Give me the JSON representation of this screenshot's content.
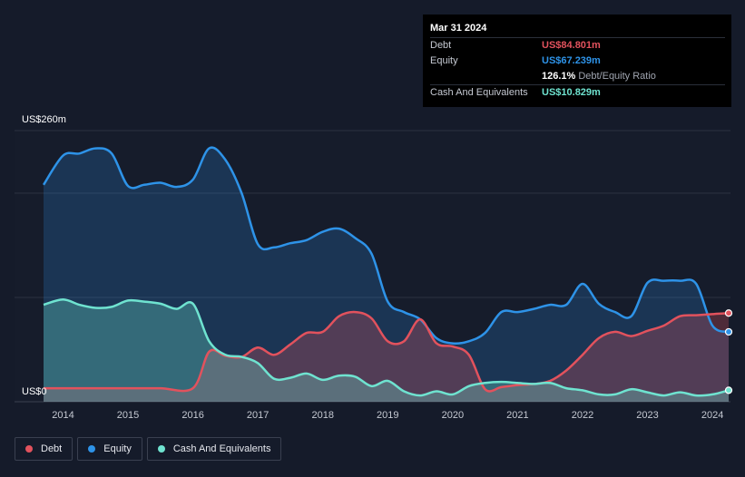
{
  "tooltip": {
    "date": "Mar 31 2024",
    "debt_label": "Debt",
    "debt_value": "US$84.801m",
    "equity_label": "Equity",
    "equity_value": "US$67.239m",
    "ratio_value": "126.1%",
    "ratio_label": "Debt/Equity Ratio",
    "cash_label": "Cash And Equivalents",
    "cash_value": "US$10.829m"
  },
  "legend": {
    "debt": "Debt",
    "equity": "Equity",
    "cash": "Cash And Equivalents"
  },
  "colors": {
    "background": "#151b2a",
    "debt": "#e2525d",
    "equity": "#2e93e8",
    "cash": "#6fe3d0",
    "grid": "#2c3242"
  },
  "chart_data": {
    "type": "area",
    "y_top_label": "US$260m",
    "y_bottom_label": "US$0",
    "ylim": [
      0,
      260
    ],
    "xlim": [
      2013.7,
      2024.25
    ],
    "x_ticks": [
      2014,
      2015,
      2016,
      2017,
      2018,
      2019,
      2020,
      2021,
      2022,
      2023,
      2024
    ],
    "x_tick_labels": [
      "2014",
      "2015",
      "2016",
      "2017",
      "2018",
      "2019",
      "2020",
      "2021",
      "2022",
      "2023",
      "2024"
    ],
    "grid": true,
    "legend_position": "bottom-left",
    "series": [
      {
        "name": "Debt",
        "color": "#e2525d",
        "x": [
          2013.7,
          2014.0,
          2014.5,
          2015.0,
          2015.5,
          2016.0,
          2016.25,
          2016.5,
          2016.75,
          2017.0,
          2017.25,
          2017.5,
          2017.75,
          2018.0,
          2018.25,
          2018.5,
          2018.75,
          2019.0,
          2019.25,
          2019.5,
          2019.75,
          2020.0,
          2020.25,
          2020.5,
          2020.75,
          2021.0,
          2021.25,
          2021.5,
          2021.75,
          2022.0,
          2022.25,
          2022.5,
          2022.75,
          2023.0,
          2023.25,
          2023.5,
          2023.75,
          2024.0,
          2024.25
        ],
        "values": [
          13,
          13,
          13,
          13,
          13,
          13,
          48,
          44,
          43,
          52,
          45,
          55,
          66,
          67,
          82,
          86,
          80,
          58,
          58,
          79,
          56,
          53,
          45,
          12,
          14,
          16,
          17,
          20,
          30,
          45,
          61,
          67,
          63,
          68,
          73,
          82,
          83,
          84,
          85
        ]
      },
      {
        "name": "Equity",
        "color": "#2e93e8",
        "x": [
          2013.7,
          2014.0,
          2014.25,
          2014.5,
          2014.75,
          2015.0,
          2015.25,
          2015.5,
          2015.75,
          2016.0,
          2016.25,
          2016.5,
          2016.75,
          2017.0,
          2017.25,
          2017.5,
          2017.75,
          2018.0,
          2018.25,
          2018.5,
          2018.75,
          2019.0,
          2019.25,
          2019.5,
          2019.75,
          2020.0,
          2020.25,
          2020.5,
          2020.75,
          2021.0,
          2021.25,
          2021.5,
          2021.75,
          2022.0,
          2022.25,
          2022.5,
          2022.75,
          2023.0,
          2023.25,
          2023.5,
          2023.75,
          2024.0,
          2024.25
        ],
        "values": [
          208,
          236,
          238,
          243,
          238,
          207,
          208,
          210,
          206,
          213,
          243,
          232,
          200,
          151,
          148,
          152,
          155,
          163,
          166,
          157,
          142,
          96,
          86,
          79,
          61,
          56,
          58,
          66,
          86,
          86,
          89,
          93,
          93,
          113,
          94,
          86,
          82,
          114,
          116,
          116,
          113,
          73,
          67
        ]
      },
      {
        "name": "Cash And Equivalents",
        "color": "#6fe3d0",
        "x": [
          2013.7,
          2014.0,
          2014.25,
          2014.5,
          2014.75,
          2015.0,
          2015.25,
          2015.5,
          2015.75,
          2016.0,
          2016.25,
          2016.5,
          2016.75,
          2017.0,
          2017.25,
          2017.5,
          2017.75,
          2018.0,
          2018.25,
          2018.5,
          2018.75,
          2019.0,
          2019.25,
          2019.5,
          2019.75,
          2020.0,
          2020.25,
          2020.5,
          2020.75,
          2021.0,
          2021.25,
          2021.5,
          2021.75,
          2022.0,
          2022.25,
          2022.5,
          2022.75,
          2023.0,
          2023.25,
          2023.5,
          2023.75,
          2024.0,
          2024.25
        ],
        "values": [
          93,
          98,
          93,
          90,
          91,
          97,
          96,
          94,
          89,
          94,
          58,
          45,
          43,
          37,
          22,
          23,
          27,
          21,
          25,
          24,
          15,
          20,
          10,
          6,
          10,
          7,
          15,
          18,
          19,
          18,
          17,
          18,
          13,
          11,
          7,
          7,
          12,
          9,
          6,
          9,
          6,
          7,
          11
        ]
      }
    ]
  }
}
